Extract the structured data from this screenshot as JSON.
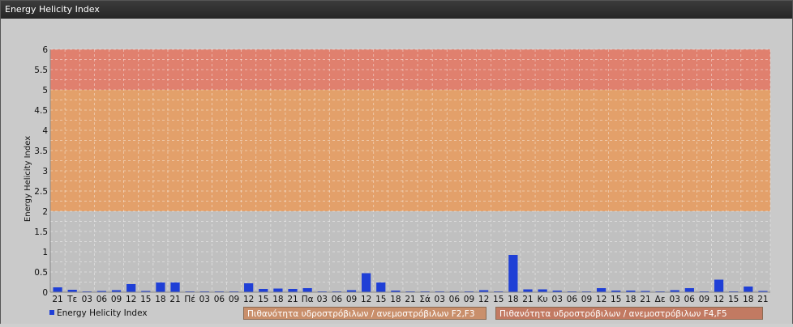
{
  "window": {
    "title": "Energy Helicity Index"
  },
  "colors": {
    "bar": "#1f3fd6",
    "band_low": "#c0c0c0",
    "band_mid": "#e3a06a",
    "band_high": "#e0806e",
    "grid": "#ffffff"
  },
  "chart_data": {
    "type": "bar",
    "title": "",
    "ylabel": "Energy Helicity Index",
    "xlabel": "",
    "ylim": [
      0,
      6
    ],
    "yticks": [
      "0",
      "0.5",
      "1",
      "1.5",
      "2",
      "2.5",
      "3",
      "3.5",
      "4",
      "4.5",
      "5",
      "5.5",
      "6"
    ],
    "grid": true,
    "legend_position": "bottom-left",
    "categories": [
      "21",
      "Τε",
      "03",
      "06",
      "09",
      "12",
      "15",
      "18",
      "21",
      "Πέ",
      "03",
      "06",
      "09",
      "12",
      "15",
      "18",
      "21",
      "Πα",
      "03",
      "06",
      "09",
      "12",
      "15",
      "18",
      "21",
      "Σά",
      "03",
      "06",
      "09",
      "12",
      "15",
      "18",
      "21",
      "Κυ",
      "03",
      "06",
      "09",
      "12",
      "15",
      "18",
      "21",
      "Δε",
      "03",
      "06",
      "09",
      "12",
      "15",
      "18",
      "21"
    ],
    "series": [
      {
        "name": "Energy Helicity Index",
        "values": [
          0.12,
          0.06,
          0.02,
          0.03,
          0.05,
          0.2,
          0.03,
          0.24,
          0.24,
          0.02,
          0.02,
          0.02,
          0.02,
          0.22,
          0.08,
          0.09,
          0.08,
          0.1,
          0.02,
          0.02,
          0.05,
          0.47,
          0.24,
          0.04,
          0.02,
          0.02,
          0.02,
          0.02,
          0.02,
          0.05,
          0.02,
          0.92,
          0.07,
          0.07,
          0.04,
          0.02,
          0.02,
          0.1,
          0.04,
          0.04,
          0.03,
          0.02,
          0.05,
          0.1,
          0.02,
          0.31,
          0.02,
          0.14,
          0.03
        ]
      }
    ],
    "bands": [
      {
        "from": 0,
        "to": 2,
        "color": "#c0c0c0"
      },
      {
        "from": 2,
        "to": 5,
        "color": "#e3a06a",
        "label": "Πιθανότητα υδροστρόβιλων / ανεμοστρόβιλων F2,F3"
      },
      {
        "from": 5,
        "to": 6,
        "color": "#e0806e",
        "label": "Πιθανότητα υδροστρόβιλων / ανεμοστρόβιλων F4,F5"
      }
    ]
  }
}
